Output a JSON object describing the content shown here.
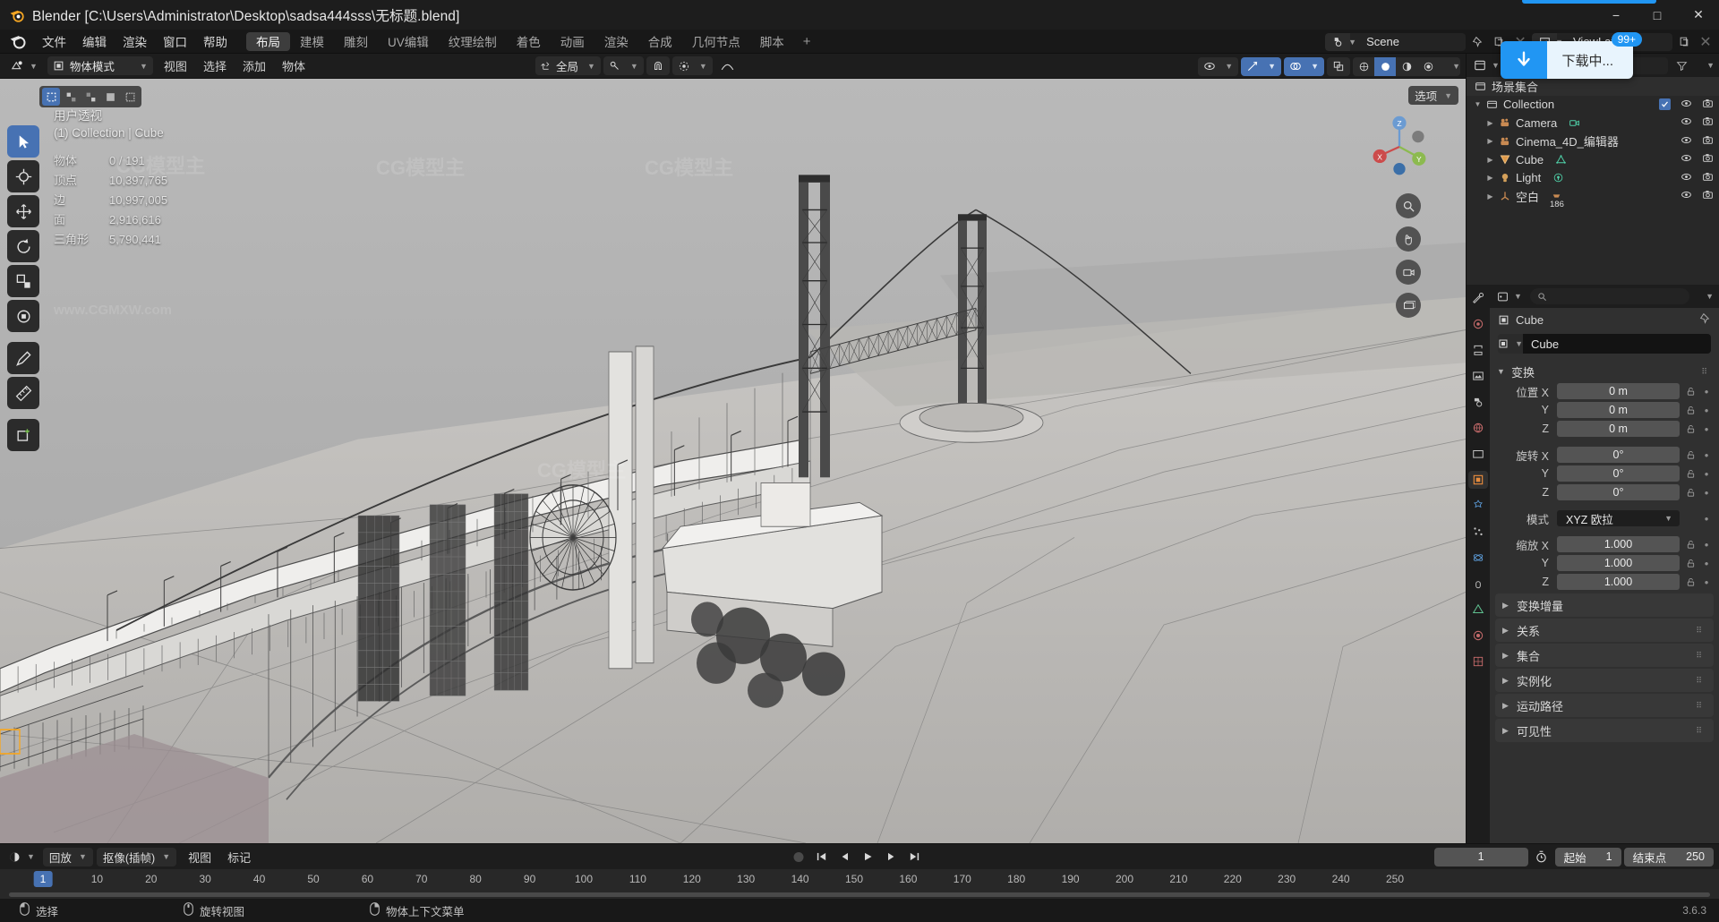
{
  "window": {
    "title": "Blender [C:\\Users\\Administrator\\Desktop\\sadsa444sss\\无标题.blend]",
    "minimize": "−",
    "maximize": "□",
    "close": "✕"
  },
  "topbar": {
    "menus": [
      "文件",
      "编辑",
      "渲染",
      "窗口",
      "帮助"
    ],
    "workspaces": [
      "布局",
      "建模",
      "雕刻",
      "UV编辑",
      "纹理绘制",
      "着色",
      "动画",
      "渲染",
      "合成",
      "几何节点",
      "脚本"
    ],
    "active_workspace": "布局",
    "add_workspace": "+",
    "scene_name": "Scene",
    "viewlayer_name": "ViewLayer"
  },
  "download_toast": {
    "label": "下载中...",
    "badge": "99+",
    "accent": "#2196f3"
  },
  "viewport_header": {
    "mode": "物体模式",
    "menus": [
      "视图",
      "选择",
      "添加",
      "物体"
    ],
    "transform_orientation": "全局",
    "snap_label": "",
    "proportional_label": ""
  },
  "viewport": {
    "overlay_title": "用户透视",
    "overlay_subtitle": "(1) Collection | Cube",
    "stats": [
      {
        "key": "物体",
        "value": "0 / 191"
      },
      {
        "key": "顶点",
        "value": "10,397,765"
      },
      {
        "key": "边",
        "value": "10,997,005"
      },
      {
        "key": "面",
        "value": "2,916,616"
      },
      {
        "key": "三角形",
        "value": "5,790,441"
      }
    ],
    "options_label": "选项",
    "gizmo_axes": [
      "X",
      "Y",
      "Z"
    ]
  },
  "outliner": {
    "header_title": "场景集合",
    "search_placeholder": "",
    "rows": [
      {
        "label": "Collection",
        "icon": "collection-icon",
        "indent": 0,
        "expanded": true,
        "checkbox": true
      },
      {
        "label": "Camera",
        "icon": "camera-object-icon",
        "indent": 1,
        "data_icon": "camera-data-icon"
      },
      {
        "label": "Cinema_4D_编辑器",
        "icon": "camera-object-icon",
        "indent": 1,
        "data_icon": ""
      },
      {
        "label": "Cube",
        "icon": "mesh-object-icon",
        "indent": 1,
        "data_icon": "mesh-data-icon"
      },
      {
        "label": "Light",
        "icon": "light-object-icon",
        "indent": 1,
        "data_icon": "light-data-icon"
      },
      {
        "label": "空白",
        "icon": "empty-object-icon",
        "indent": 1,
        "data_icon": "empty-data-icon",
        "count": "186"
      }
    ]
  },
  "properties": {
    "breadcrumb_object": "Cube",
    "name_field_value": "Cube",
    "search_placeholder": "",
    "transform": {
      "title": "变换",
      "location_label": "位置",
      "rotation_label": "旋转",
      "scale_label": "缩放",
      "mode_label": "模式",
      "rotation_mode_value": "XYZ 欧拉",
      "axes": [
        "X",
        "Y",
        "Z"
      ],
      "location": [
        "0 m",
        "0 m",
        "0 m"
      ],
      "rotation": [
        "0°",
        "0°",
        "0°"
      ],
      "scale": [
        "1.000",
        "1.000",
        "1.000"
      ]
    },
    "panels": [
      "变换增量",
      "关系",
      "集合",
      "实例化",
      "运动路径",
      "可见性"
    ]
  },
  "timeline": {
    "editor_label": "回放",
    "keying_label": "抠像(插帧)",
    "menus": [
      "视图",
      "标记"
    ],
    "current_frame": "1",
    "start_label": "起始",
    "start_value": "1",
    "end_label": "结束点",
    "end_value": "250",
    "ticks": [
      "1",
      "10",
      "20",
      "30",
      "40",
      "50",
      "60",
      "70",
      "80",
      "90",
      "100",
      "110",
      "120",
      "130",
      "140",
      "150",
      "160",
      "170",
      "180",
      "190",
      "200",
      "210",
      "220",
      "230",
      "240",
      "250"
    ],
    "playhead_label": "1"
  },
  "statusbar": {
    "items": [
      {
        "icon": "mouse-left-icon",
        "label": "选择"
      },
      {
        "icon": "mouse-middle-icon",
        "label": "旋转视图"
      },
      {
        "icon": "mouse-right-icon",
        "label": "物体上下文菜单"
      }
    ],
    "version": "3.6.3"
  },
  "watermarks": [
    "CG模型主",
    "www.CGMXW.com"
  ]
}
